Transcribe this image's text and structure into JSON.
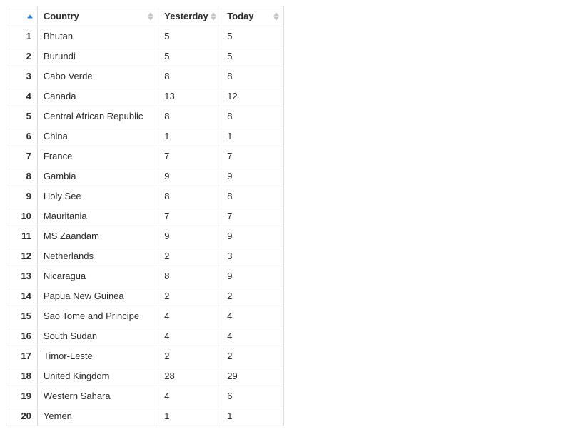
{
  "table": {
    "headers": {
      "index": "",
      "country": "Country",
      "yesterday": "Yesterday",
      "today": "Today"
    },
    "rows": [
      {
        "idx": "1",
        "country": "Bhutan",
        "yesterday": "5",
        "today": "5"
      },
      {
        "idx": "2",
        "country": "Burundi",
        "yesterday": "5",
        "today": "5"
      },
      {
        "idx": "3",
        "country": "Cabo Verde",
        "yesterday": "8",
        "today": "8"
      },
      {
        "idx": "4",
        "country": "Canada",
        "yesterday": "13",
        "today": "12"
      },
      {
        "idx": "5",
        "country": "Central African Republic",
        "yesterday": "8",
        "today": "8"
      },
      {
        "idx": "6",
        "country": "China",
        "yesterday": "1",
        "today": "1"
      },
      {
        "idx": "7",
        "country": "France",
        "yesterday": "7",
        "today": "7"
      },
      {
        "idx": "8",
        "country": "Gambia",
        "yesterday": "9",
        "today": "9"
      },
      {
        "idx": "9",
        "country": "Holy See",
        "yesterday": "8",
        "today": "8"
      },
      {
        "idx": "10",
        "country": "Mauritania",
        "yesterday": "7",
        "today": "7"
      },
      {
        "idx": "11",
        "country": "MS Zaandam",
        "yesterday": "9",
        "today": "9"
      },
      {
        "idx": "12",
        "country": "Netherlands",
        "yesterday": "2",
        "today": "3"
      },
      {
        "idx": "13",
        "country": "Nicaragua",
        "yesterday": "8",
        "today": "9"
      },
      {
        "idx": "14",
        "country": "Papua New Guinea",
        "yesterday": "2",
        "today": "2"
      },
      {
        "idx": "15",
        "country": "Sao Tome and Principe",
        "yesterday": "4",
        "today": "4"
      },
      {
        "idx": "16",
        "country": "South Sudan",
        "yesterday": "4",
        "today": "4"
      },
      {
        "idx": "17",
        "country": "Timor-Leste",
        "yesterday": "2",
        "today": "2"
      },
      {
        "idx": "18",
        "country": "United Kingdom",
        "yesterday": "28",
        "today": "29"
      },
      {
        "idx": "19",
        "country": "Western Sahara",
        "yesterday": "4",
        "today": "6"
      },
      {
        "idx": "20",
        "country": "Yemen",
        "yesterday": "1",
        "today": "1"
      }
    ]
  }
}
